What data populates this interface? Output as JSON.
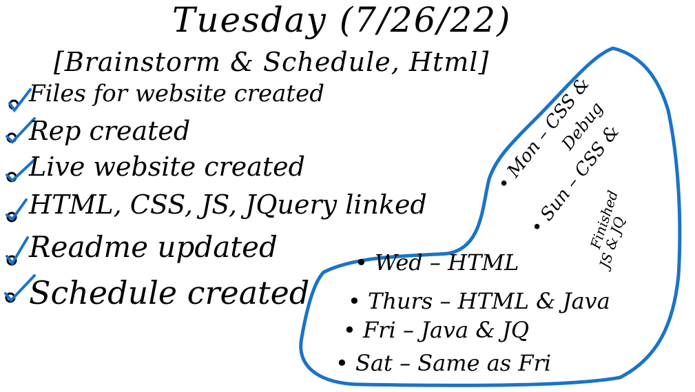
{
  "header": {
    "title": "Tuesday (7/26/22)",
    "subtitle": "[Brainstorm & Schedule, Html]"
  },
  "checklist": [
    {
      "label": "Files for website created",
      "checked": true
    },
    {
      "label": "Rep created",
      "checked": true
    },
    {
      "label": "Live website created",
      "checked": true
    },
    {
      "label": "HTML, CSS, JS, JQuery linked",
      "checked": true
    },
    {
      "label": "Readme updated",
      "checked": true
    },
    {
      "label": "Schedule created",
      "checked": true
    }
  ],
  "schedule": {
    "wed": "• Wed – HTML",
    "thurs": "• Thurs – HTML & Java",
    "fri": "• Fri – Java & JQ",
    "sat": "• Sat – Same as Fri",
    "mon": "• Mon – CSS &",
    "mon_sub": "Debug",
    "sun": "• Sun – CSS &",
    "sun_sub": "Finished",
    "sun_sub2": "JS & JQ"
  },
  "colors": {
    "ink": "#000000",
    "check": "#1a73c8",
    "outline": "#1a73c8",
    "background": "#ffffff"
  },
  "icons": {
    "check": "check-icon",
    "bullet": "bullet-icon"
  }
}
